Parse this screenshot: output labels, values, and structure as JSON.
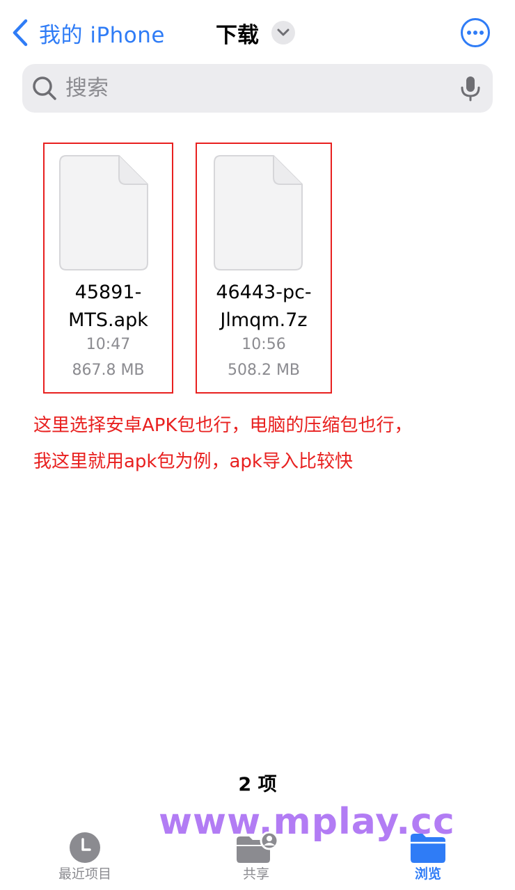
{
  "nav": {
    "back_label": "我的 iPhone",
    "title": "下载"
  },
  "search": {
    "placeholder": "搜索"
  },
  "files": [
    {
      "name": "45891-\nMTS.apk",
      "time": "10:47",
      "size": "867.8 MB"
    },
    {
      "name": "46443-pc-\nJlmqm.7z",
      "time": "10:56",
      "size": "508.2 MB"
    }
  ],
  "annotation": {
    "line1": "这里选择安卓APK包也行，电脑的压缩包也行，",
    "line2": "我这里就用apk包为例，apk导入比较快"
  },
  "item_count": "2 项",
  "watermark": "www.mplay.cc",
  "tabs": [
    {
      "label": "最近项目",
      "icon": "clock-icon"
    },
    {
      "label": "共享",
      "icon": "shared-folder-icon"
    },
    {
      "label": "浏览",
      "icon": "folder-icon",
      "selected": true
    }
  ],
  "colors": {
    "accent": "#2f7cf6",
    "annotation": "#e8201f",
    "watermark": "#b27cf4",
    "secondary_text": "#8b8b90"
  }
}
